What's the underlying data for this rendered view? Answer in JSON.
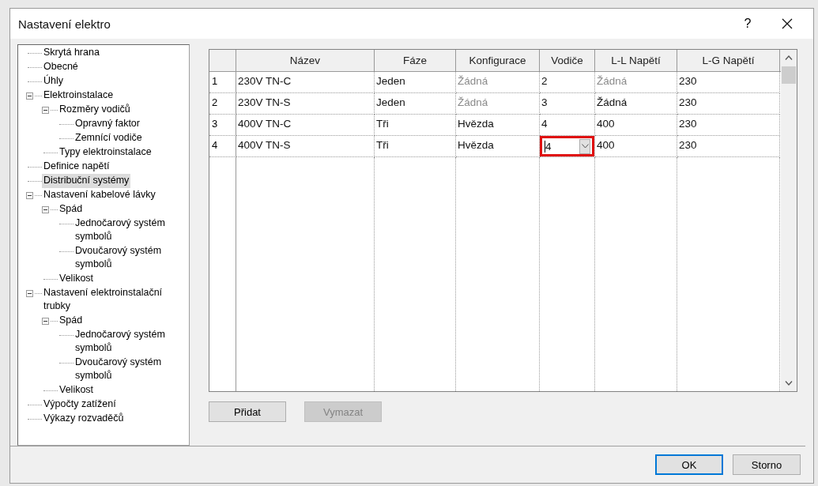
{
  "window": {
    "title": "Nastavení elektro",
    "help": "?"
  },
  "tree": [
    {
      "label": "Skrytá hrana",
      "selected": false
    },
    {
      "label": "Obecné",
      "selected": false
    },
    {
      "label": "Úhly",
      "selected": false
    },
    {
      "label": "Elektroinstalace",
      "selected": false,
      "expanded": true,
      "children": [
        {
          "label": "Rozměry vodičů",
          "selected": false,
          "expanded": true,
          "children": [
            {
              "label": "Opravný faktor",
              "selected": false
            },
            {
              "label": "Zemnící vodiče",
              "selected": false
            }
          ]
        },
        {
          "label": "Typy elektroinstalace",
          "selected": false
        }
      ]
    },
    {
      "label": "Definice napětí",
      "selected": false
    },
    {
      "label": "Distribuční systémy",
      "selected": true
    },
    {
      "label": "Nastavení kabelové lávky",
      "selected": false,
      "expanded": true,
      "children": [
        {
          "label": "Spád",
          "selected": false,
          "expanded": true,
          "children": [
            {
              "label": "Jednočarový systém symbolů",
              "selected": false
            },
            {
              "label": "Dvoučarový systém symbolů",
              "selected": false
            }
          ]
        },
        {
          "label": "Velikost",
          "selected": false
        }
      ]
    },
    {
      "label": "Nastavení elektroinstalační trubky",
      "selected": false,
      "expanded": true,
      "children": [
        {
          "label": "Spád",
          "selected": false,
          "expanded": true,
          "children": [
            {
              "label": "Jednočarový systém symbolů",
              "selected": false
            },
            {
              "label": "Dvoučarový systém symbolů",
              "selected": false
            }
          ]
        },
        {
          "label": "Velikost",
          "selected": false
        }
      ]
    },
    {
      "label": "Výpočty zatížení",
      "selected": false
    },
    {
      "label": "Výkazy rozvaděčů",
      "selected": false
    }
  ],
  "table": {
    "columns": [
      "Název",
      "Fáze",
      "Konfigurace",
      "Vodiče",
      "L-L Napětí",
      "L-G Napětí"
    ],
    "rows": [
      {
        "number": "1",
        "cells": [
          {
            "text": "230V TN-C",
            "disabled": false
          },
          {
            "text": "Jeden",
            "disabled": false
          },
          {
            "text": "Žádná",
            "disabled": true
          },
          {
            "text": "2",
            "disabled": false
          },
          {
            "text": "Žádná",
            "disabled": true
          },
          {
            "text": "230",
            "disabled": false
          }
        ]
      },
      {
        "number": "2",
        "cells": [
          {
            "text": "230V TN-S",
            "disabled": false
          },
          {
            "text": "Jeden",
            "disabled": false
          },
          {
            "text": "Žádná",
            "disabled": true
          },
          {
            "text": "3",
            "disabled": false
          },
          {
            "text": "Žádná",
            "disabled": false
          },
          {
            "text": "230",
            "disabled": false
          }
        ]
      },
      {
        "number": "3",
        "cells": [
          {
            "text": "400V TN-C",
            "disabled": false
          },
          {
            "text": "Tři",
            "disabled": false
          },
          {
            "text": "Hvězda",
            "disabled": false
          },
          {
            "text": "4",
            "disabled": false
          },
          {
            "text": "400",
            "disabled": false
          },
          {
            "text": "230",
            "disabled": false
          }
        ]
      },
      {
        "number": "4",
        "cells": [
          {
            "text": "400V TN-S",
            "disabled": false
          },
          {
            "text": "Tři",
            "disabled": false
          },
          {
            "text": "Hvězda",
            "disabled": false
          },
          {
            "text": "4",
            "disabled": false,
            "kind": "dropdown",
            "highlighted": true
          },
          {
            "text": "400",
            "disabled": false
          },
          {
            "text": "230",
            "disabled": false
          }
        ]
      }
    ]
  },
  "table_buttons": [
    {
      "label": "Přidat",
      "disabled": false
    },
    {
      "label": "Vymazat",
      "disabled": true
    }
  ],
  "buttons": [
    {
      "label": "OK",
      "default": true
    },
    {
      "label": "Storno",
      "default": false
    }
  ]
}
